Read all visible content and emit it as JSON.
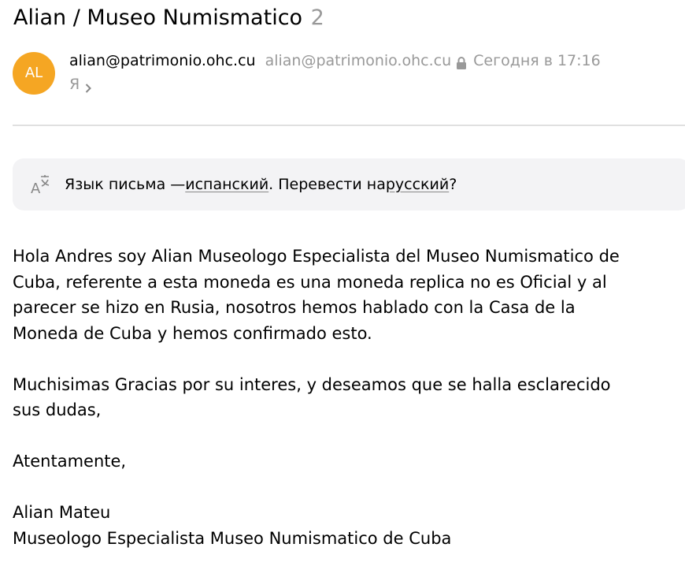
{
  "email": {
    "subject": "Alian / Museo Numismatico",
    "thread_count": "2",
    "avatar_initials": "AL",
    "avatar_color": "#f5a623",
    "sender_name": "alian@patrimonio.ohc.cu",
    "sender_email": "alian@patrimonio.ohc.cu",
    "date": "Сегодня в 17:16",
    "recipient": "Я",
    "icons": [
      "lock-icon",
      "chevron-right-icon",
      "translate-icon"
    ]
  },
  "translate": {
    "prefix": "Язык письма — ",
    "source_lang": "испанский",
    "middle": ". Перевести на ",
    "target_lang": "русский",
    "suffix": "?"
  },
  "body": {
    "p1": [
      "Hola Andres soy Alian Museologo Especialista del Museo Numismatico de",
      "Cuba, referente a esta moneda es una moneda replica no es Oficial y al",
      "parecer se hizo en Rusia, nosotros hemos hablado con la Casa de la",
      "Moneda de Cuba y hemos confirmado esto."
    ],
    "p2": [
      "Muchisimas Gracias por su interes, y deseamos que se halla esclarecido",
      "sus dudas,"
    ],
    "p3": [
      "Atentamente,"
    ],
    "p4": [
      "Alian Mateu",
      "Museologo Especialista Museo Numismatico de Cuba"
    ]
  }
}
